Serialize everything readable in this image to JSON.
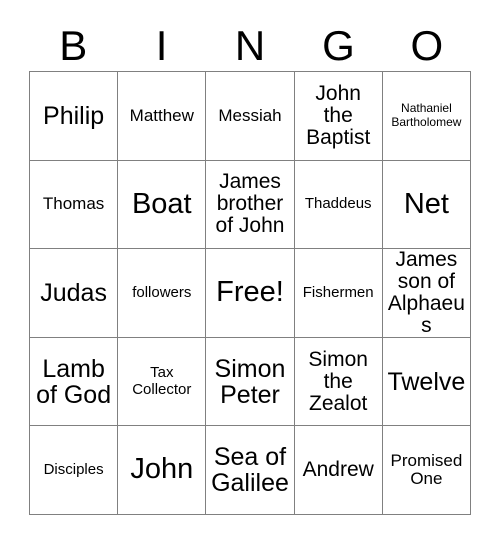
{
  "card": {
    "type": "bingo-card",
    "header_letters": [
      "B",
      "I",
      "N",
      "G",
      "O"
    ],
    "columns": 5,
    "rows": 5,
    "free_space_index": 12,
    "colors": {
      "background": "#ffffff",
      "text": "#000000",
      "grid_line": "#808080"
    },
    "cells": [
      {
        "text": "Philip",
        "size": "xl"
      },
      {
        "text": "Matthew",
        "size": "md"
      },
      {
        "text": "Messiah",
        "size": "md"
      },
      {
        "text": "John\nthe\nBaptist",
        "size": "lg"
      },
      {
        "text": "Nathaniel\nBartholomew",
        "size": "xs"
      },
      {
        "text": "Thomas",
        "size": "md"
      },
      {
        "text": "Boat",
        "size": "2xl"
      },
      {
        "text": "James\nbrother\nof John",
        "size": "lg"
      },
      {
        "text": "Thaddeus",
        "size": "sm"
      },
      {
        "text": "Net",
        "size": "2xl"
      },
      {
        "text": "Judas",
        "size": "xl"
      },
      {
        "text": "followers",
        "size": "sm"
      },
      {
        "text": "Free!",
        "size": "2xl"
      },
      {
        "text": "Fishermen",
        "size": "sm"
      },
      {
        "text": "James\nson of\nAlphaeus",
        "size": "lg"
      },
      {
        "text": "Lamb\nof God",
        "size": "xl"
      },
      {
        "text": "Tax\nCollector",
        "size": "sm"
      },
      {
        "text": "Simon\nPeter",
        "size": "xl"
      },
      {
        "text": "Simon\nthe\nZealot",
        "size": "lg"
      },
      {
        "text": "Twelve",
        "size": "xl"
      },
      {
        "text": "Disciples",
        "size": "sm"
      },
      {
        "text": "John",
        "size": "2xl"
      },
      {
        "text": "Sea of\nGalilee",
        "size": "xl"
      },
      {
        "text": "Andrew",
        "size": "lg"
      },
      {
        "text": "Promised\nOne",
        "size": "md"
      }
    ]
  }
}
